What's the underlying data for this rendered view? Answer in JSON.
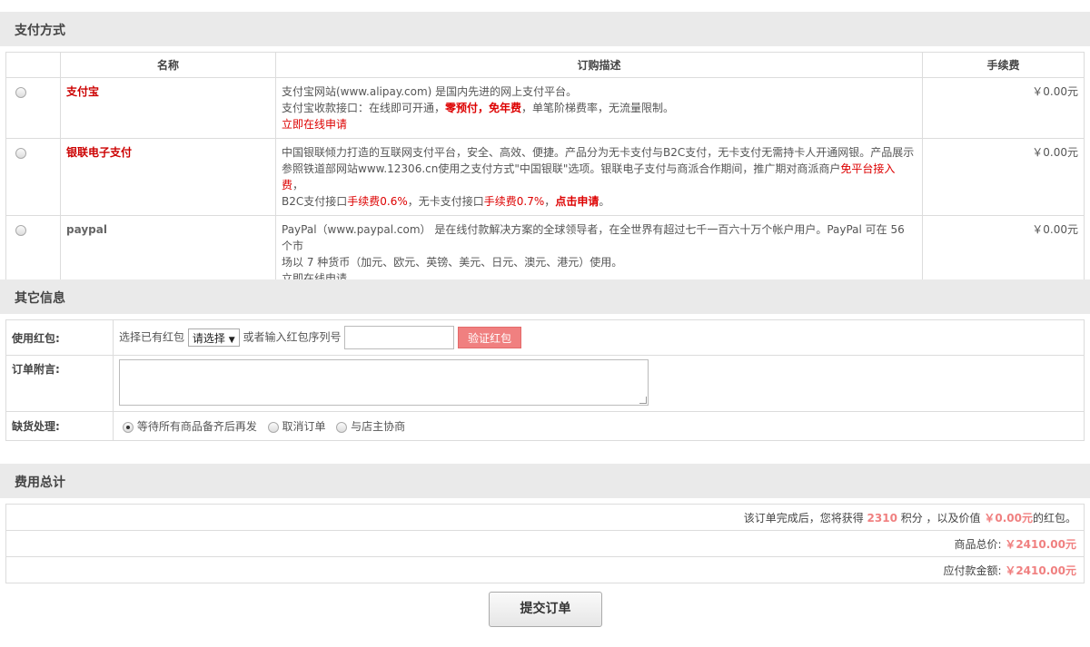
{
  "payment": {
    "section_title": "支付方式",
    "headers": {
      "name": "名称",
      "description": "订购描述",
      "fee": "手续费"
    },
    "alipay": {
      "name": "支付宝",
      "line1": "支付宝网站(www.alipay.com) 是国内先进的网上支付平台。",
      "line2_a": "支付宝收款接口：在线即可开通，",
      "line2_b": "零预付，免年费",
      "line2_c": "，单笔阶梯费率，无流量限制。",
      "apply": "立即在线申请",
      "fee": "￥0.00元"
    },
    "unionpay": {
      "name": "银联电子支付",
      "line1": "中国银联倾力打造的互联网支付平台，安全、高效、便捷。产品分为无卡支付与B2C支付，无卡支付无需持卡人开通网银。产品展示",
      "line2_a": "参照铁道部网站www.12306.cn使用之支付方式\"中国银联\"选项。银联电子支付与商派合作期间，推广期对商派商户",
      "line2_b": "免平台接入费",
      "line2_c": "，",
      "line3_a": "B2C支付接口",
      "line3_b": "手续费",
      "line3_c": "0.6%",
      "line3_d": "，无卡支付接口",
      "line3_e": "手续费",
      "line3_f": "0.7%",
      "line3_g": "，",
      "line3_h": "点击申请",
      "line3_i": "。",
      "fee": "￥0.00元"
    },
    "paypal": {
      "name": "paypal",
      "line1": "PayPal（www.paypal.com） 是在线付款解决方案的全球领导者，在全世界有超过七千一百六十万个帐户用户。PayPal 可在 56 个市",
      "line2": "场以 7 种货币（加元、欧元、英镑、美元、日元、澳元、港元）使用。",
      "apply": "立即在线申请",
      "fee": "￥0.00元"
    }
  },
  "other": {
    "section_title": "其它信息",
    "redpacket_label": "使用红包:",
    "choose_text": "选择已有红包",
    "select_value": "请选择",
    "or_text": "或者输入红包序列号",
    "verify_label": "验证红包",
    "note_label": "订单附言:",
    "stock_label": "缺货处理:",
    "stock_options": [
      "等待所有商品备齐后再发",
      "取消订单",
      "与店主协商"
    ]
  },
  "totals": {
    "section_title": "费用总计",
    "points_a": "该订单完成后，您将获得 ",
    "points_value": "2310",
    "points_b": " 积分 ，以及价值 ",
    "points_money": "￥0.00元",
    "points_c": "的红包。",
    "goods_label": "商品总价: ",
    "goods_value": "￥2410.00元",
    "pay_label": "应付款金额: ",
    "pay_value": "￥2410.00元"
  },
  "submit_label": "提交订单"
}
